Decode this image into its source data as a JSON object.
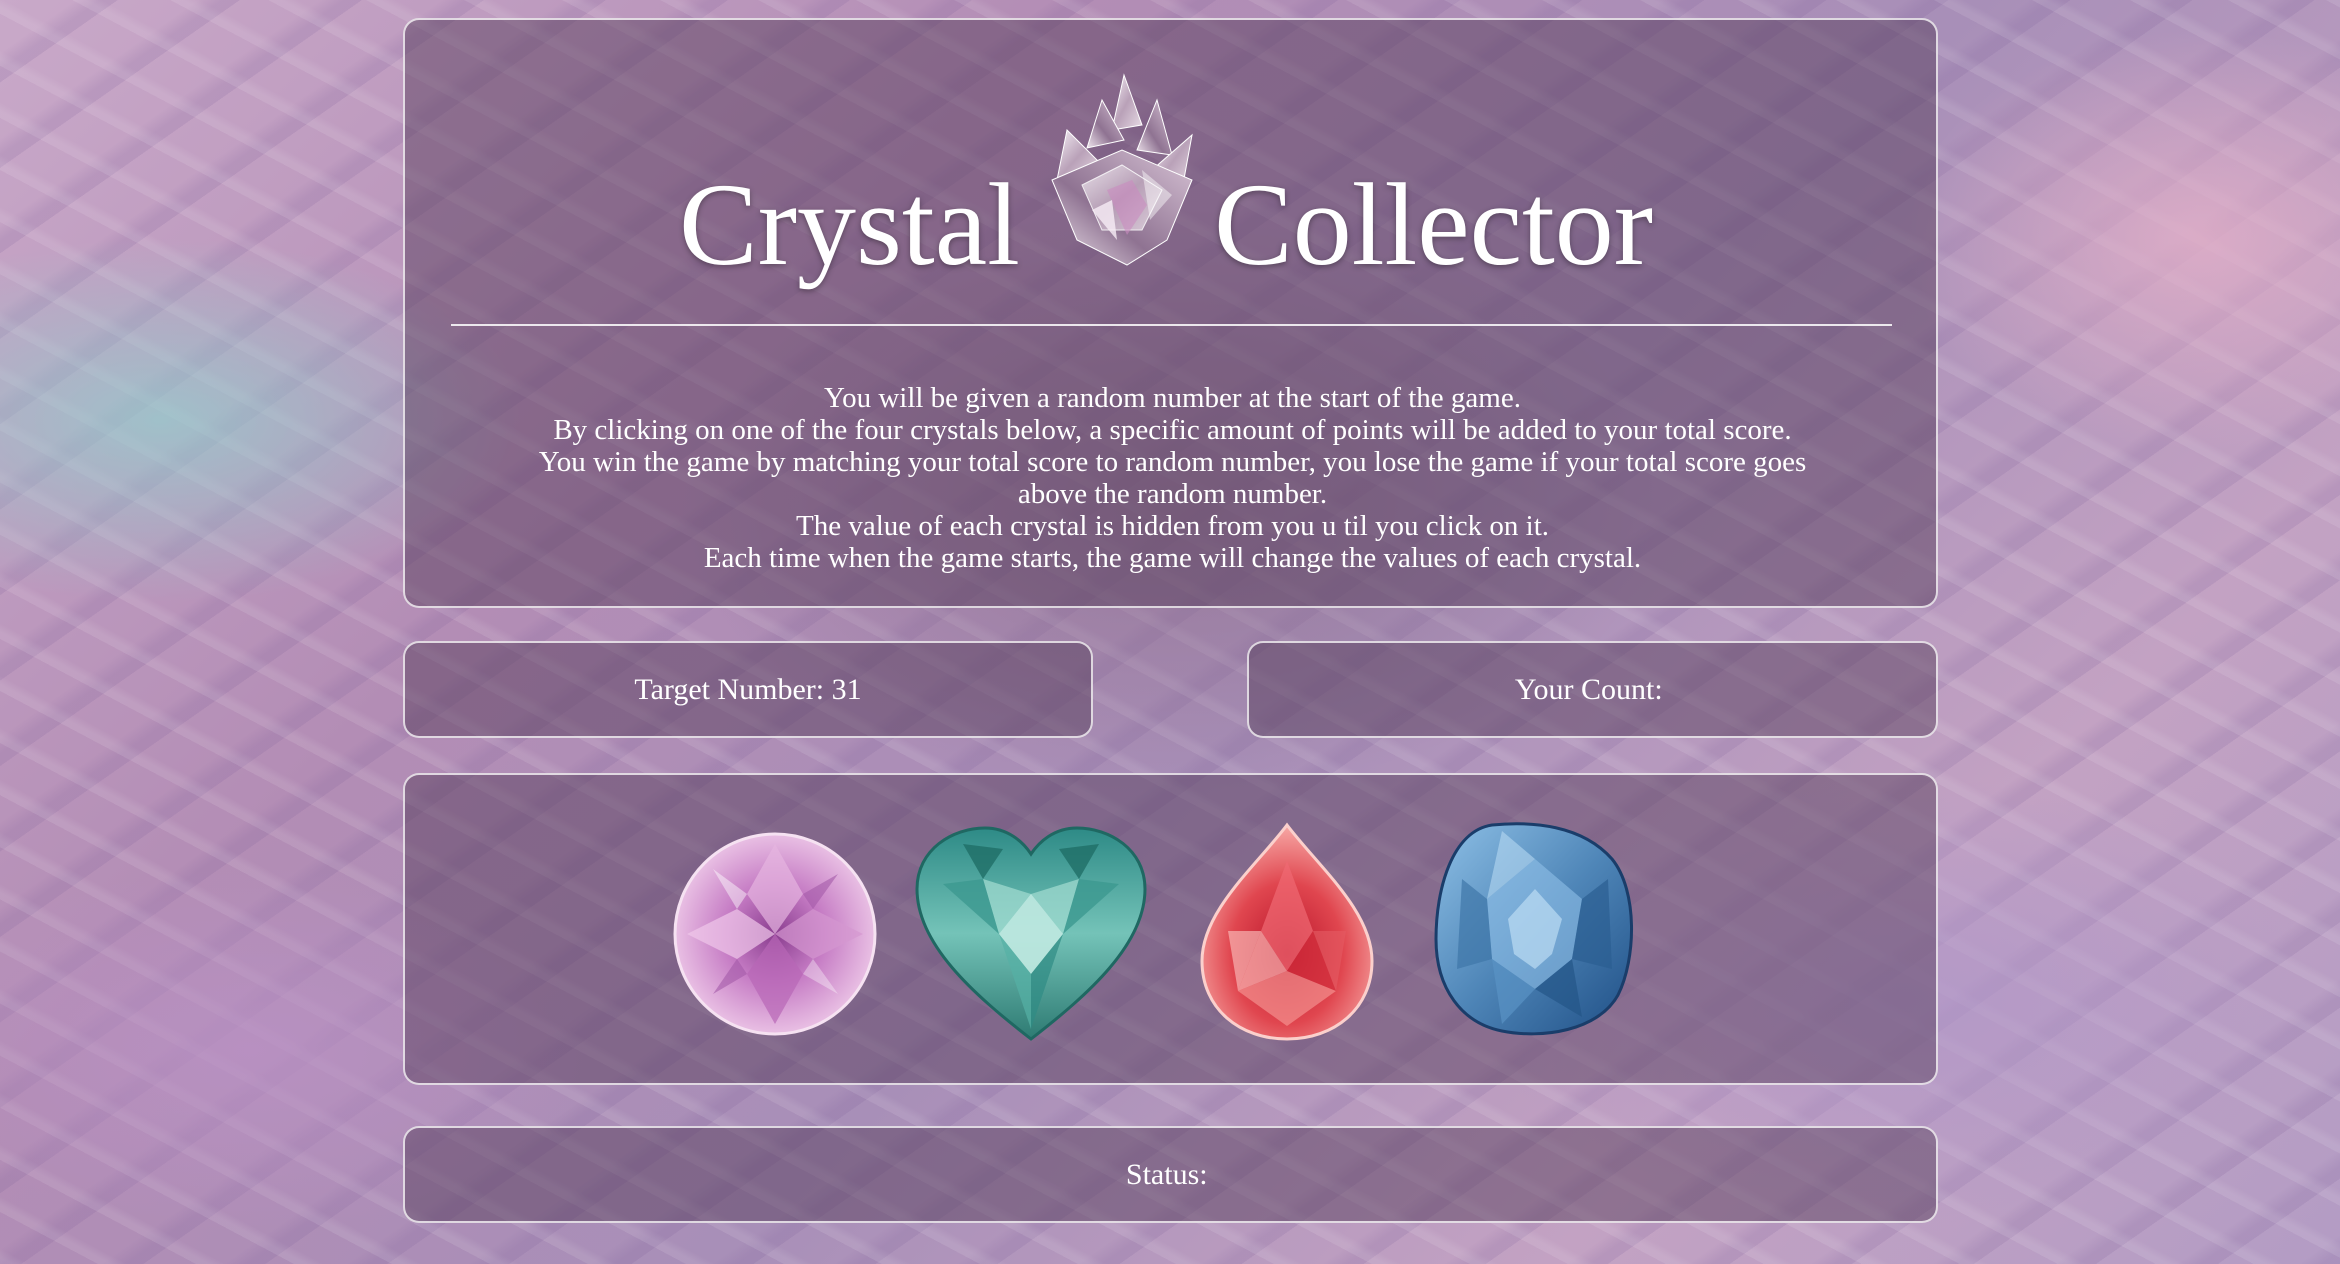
{
  "header": {
    "title_left": "Crystal",
    "title_right": "Collector",
    "instructions": [
      "You will be given a random number at the start of the game.",
      "By clicking on one of the four crystals below, a specific amount of points will be added to your total score.",
      "You win the game by matching your total score to random number, you lose the game if your total score goes",
      "above the random number.",
      "The value of each crystal is hidden from you u til you click on it.",
      "Each time when the game starts, the game will change the values of each crystal."
    ]
  },
  "target": {
    "label": "Target Number: ",
    "value": "31"
  },
  "count": {
    "label": "Your Count: ",
    "value": ""
  },
  "status": {
    "label": "Status: ",
    "value": ""
  },
  "crystals": [
    {
      "name": "pink-round-crystal",
      "color": "#c57bc4"
    },
    {
      "name": "teal-heart-crystal",
      "color": "#4fa8a0"
    },
    {
      "name": "red-pear-crystal",
      "color": "#e0464f"
    },
    {
      "name": "blue-cushion-crystal",
      "color": "#4f86b8"
    }
  ],
  "colors": {
    "text": "#ffffff",
    "panel_border": "#ffffff"
  }
}
